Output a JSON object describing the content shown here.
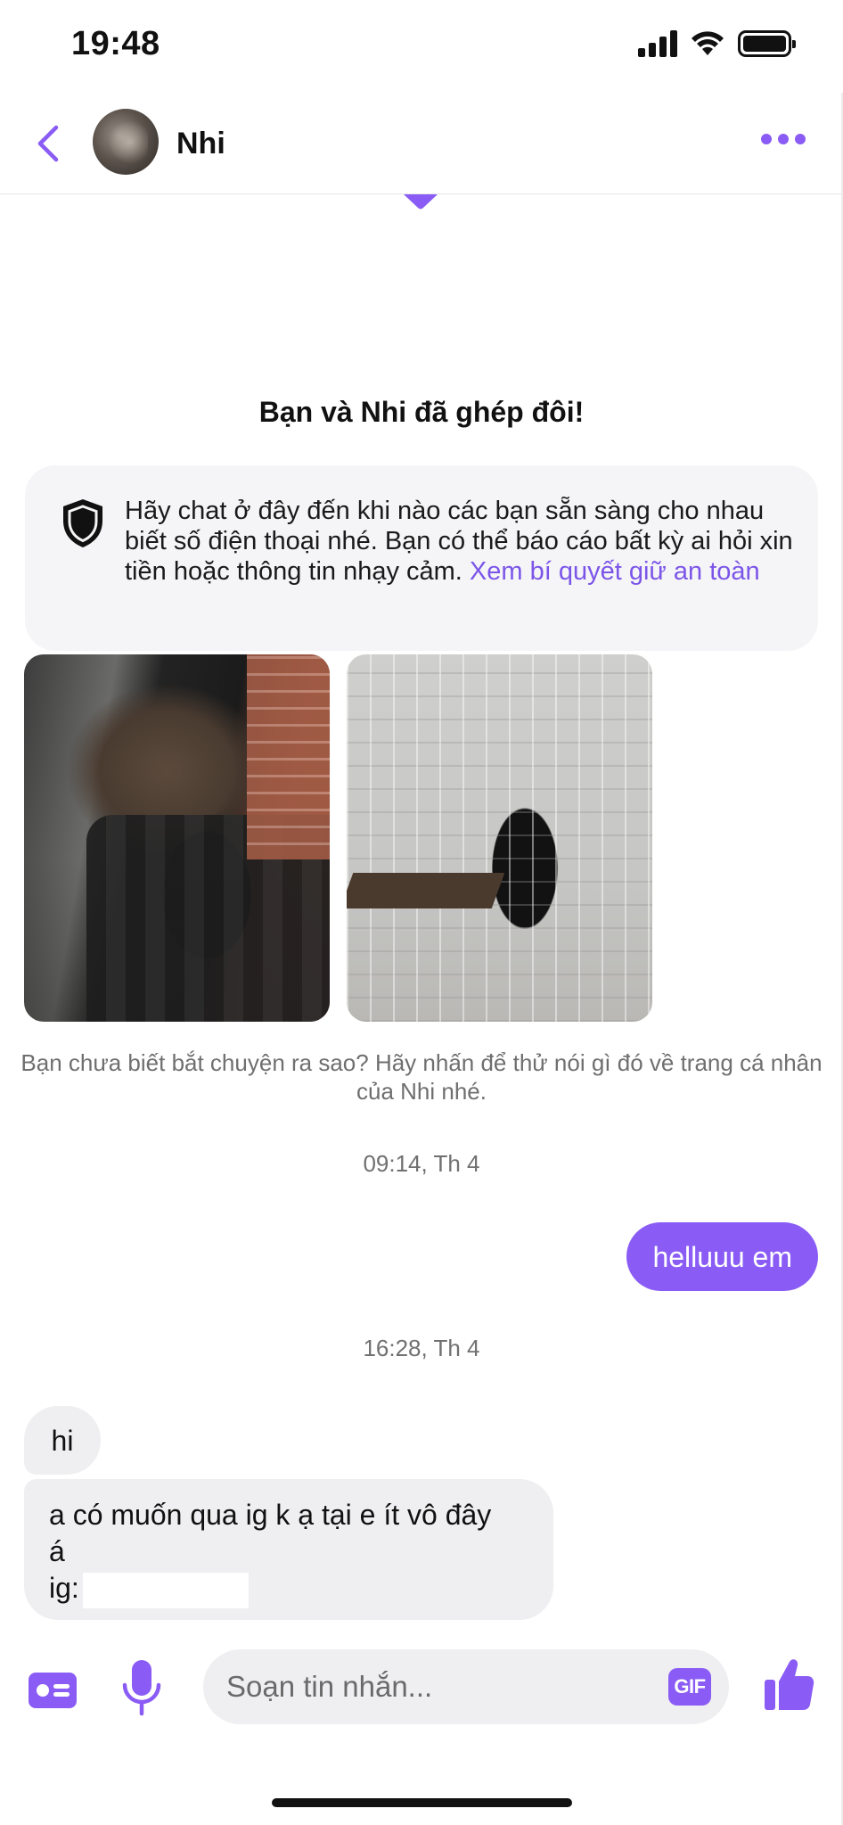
{
  "status_bar": {
    "time": "19:48"
  },
  "header": {
    "contact_name": "Nhi"
  },
  "match": {
    "title": "Bạn và Nhi đã ghép đôi!",
    "safety_text": "Hãy chat ở đây đến khi nào các bạn sẵn sàng cho nhau biết số điện thoại nhé. Bạn có thể báo cáo bất kỳ ai hỏi xin tiền hoặc thông tin nhạy cảm.",
    "safety_link": "Xem bí quyết giữ an toàn",
    "hint": "Bạn chưa biết bắt chuyện ra sao? Hãy nhấn để thử nói gì đó về trang cá nhân của Nhi nhé."
  },
  "messages": [
    {
      "timestamp": "09:14, Th 4"
    },
    {
      "direction": "out",
      "text": "helluuu em"
    },
    {
      "timestamp": "16:28, Th 4"
    },
    {
      "direction": "in",
      "text": "hi"
    },
    {
      "direction": "in",
      "lines": [
        "a có muốn qua ig k ạ tại e ít vô đây",
        "á",
        "ig:"
      ]
    }
  ],
  "composer": {
    "placeholder": "Soạn tin nhắn...",
    "gif_label": "GIF"
  },
  "colors": {
    "accent": "#8a5cf5",
    "bubble_in": "#efeff1",
    "link": "#7b55e8"
  },
  "icons": {
    "back": "chevron-left-icon",
    "more": "more-dots-icon",
    "shield": "shield-icon",
    "card": "id-card-icon",
    "mic": "microphone-icon",
    "gif": "gif-icon",
    "like": "thumbs-up-icon"
  }
}
